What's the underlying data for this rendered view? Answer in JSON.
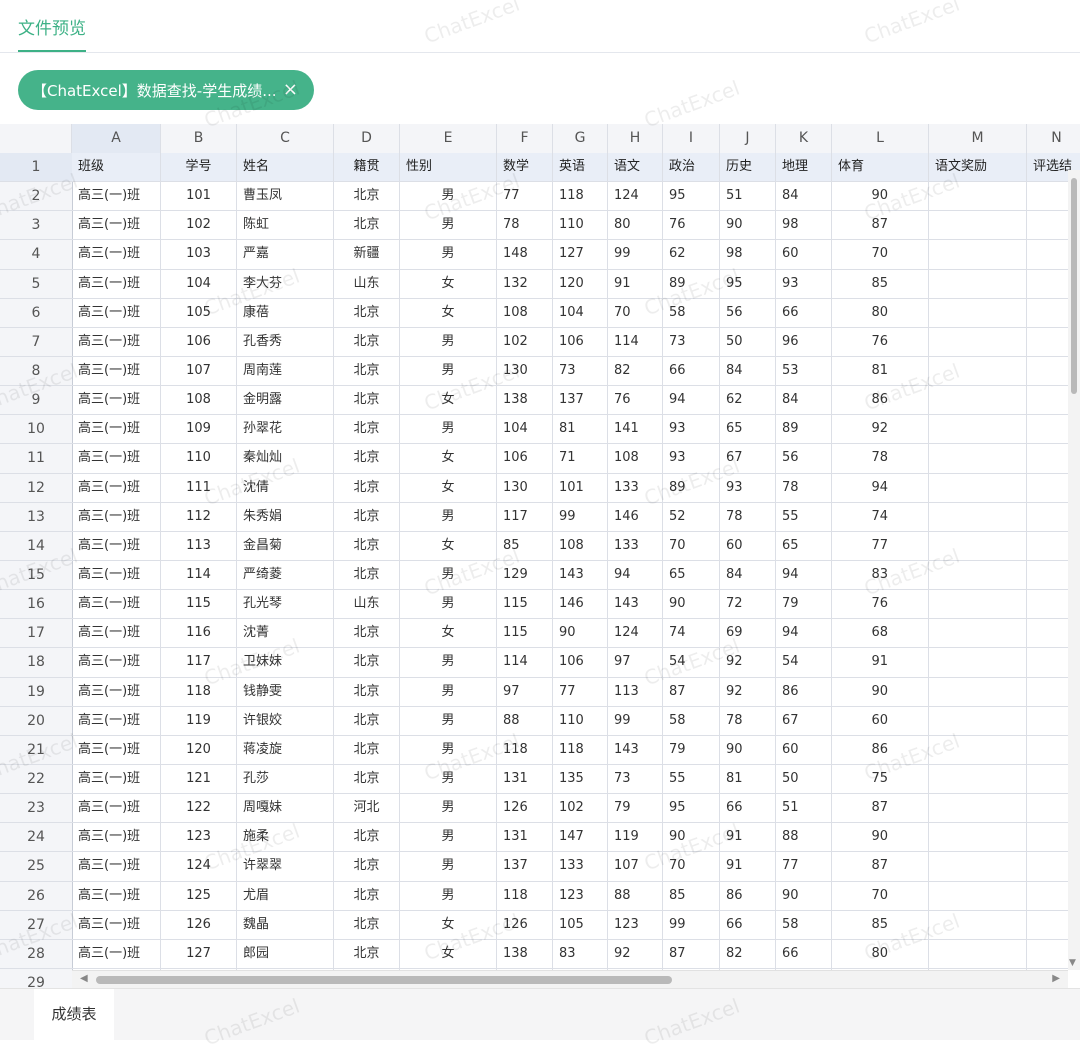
{
  "tabs": {
    "active": "文件预览"
  },
  "chip": {
    "label": "【ChatExcel】数据查找-学生成绩...",
    "close_icon": "×"
  },
  "columns": [
    "A",
    "B",
    "C",
    "D",
    "E",
    "F",
    "G",
    "H",
    "I",
    "J",
    "K",
    "L",
    "M",
    "N"
  ],
  "headers": [
    "班级",
    "学号",
    "姓名",
    "籍贯",
    "性别",
    "数学",
    "英语",
    "语文",
    "政治",
    "历史",
    "地理",
    "体育",
    "语文奖励",
    "评选结"
  ],
  "rows": [
    [
      "高三(一)班",
      "101",
      "曹玉凤",
      "北京",
      "男",
      "77",
      "118",
      "124",
      "95",
      "51",
      "84",
      "90"
    ],
    [
      "高三(一)班",
      "102",
      "陈虹",
      "北京",
      "男",
      "78",
      "110",
      "80",
      "76",
      "90",
      "98",
      "87"
    ],
    [
      "高三(一)班",
      "103",
      "严嘉",
      "新疆",
      "男",
      "148",
      "127",
      "99",
      "62",
      "98",
      "60",
      "70"
    ],
    [
      "高三(一)班",
      "104",
      "李大芬",
      "山东",
      "女",
      "132",
      "120",
      "91",
      "89",
      "95",
      "93",
      "85"
    ],
    [
      "高三(一)班",
      "105",
      "康蓓",
      "北京",
      "女",
      "108",
      "104",
      "70",
      "58",
      "56",
      "66",
      "80"
    ],
    [
      "高三(一)班",
      "106",
      "孔香秀",
      "北京",
      "男",
      "102",
      "106",
      "114",
      "73",
      "50",
      "96",
      "76"
    ],
    [
      "高三(一)班",
      "107",
      "周南莲",
      "北京",
      "男",
      "130",
      "73",
      "82",
      "66",
      "84",
      "53",
      "81"
    ],
    [
      "高三(一)班",
      "108",
      "金明露",
      "北京",
      "女",
      "138",
      "137",
      "76",
      "94",
      "62",
      "84",
      "86"
    ],
    [
      "高三(一)班",
      "109",
      "孙翠花",
      "北京",
      "男",
      "104",
      "81",
      "141",
      "93",
      "65",
      "89",
      "92"
    ],
    [
      "高三(一)班",
      "110",
      "秦灿灿",
      "北京",
      "女",
      "106",
      "71",
      "108",
      "93",
      "67",
      "56",
      "78"
    ],
    [
      "高三(一)班",
      "111",
      "沈倩",
      "北京",
      "女",
      "130",
      "101",
      "133",
      "89",
      "93",
      "78",
      "94"
    ],
    [
      "高三(一)班",
      "112",
      "朱秀娟",
      "北京",
      "男",
      "117",
      "99",
      "146",
      "52",
      "78",
      "55",
      "74"
    ],
    [
      "高三(一)班",
      "113",
      "金昌菊",
      "北京",
      "女",
      "85",
      "108",
      "133",
      "70",
      "60",
      "65",
      "77"
    ],
    [
      "高三(一)班",
      "114",
      "严绮菱",
      "北京",
      "男",
      "129",
      "143",
      "94",
      "65",
      "84",
      "94",
      "83"
    ],
    [
      "高三(一)班",
      "115",
      "孔光琴",
      "山东",
      "男",
      "115",
      "146",
      "143",
      "90",
      "72",
      "79",
      "76"
    ],
    [
      "高三(一)班",
      "116",
      "沈菁",
      "北京",
      "女",
      "115",
      "90",
      "124",
      "74",
      "69",
      "94",
      "68"
    ],
    [
      "高三(一)班",
      "117",
      "卫妹妹",
      "北京",
      "男",
      "114",
      "106",
      "97",
      "54",
      "92",
      "54",
      "91"
    ],
    [
      "高三(一)班",
      "118",
      "钱静雯",
      "北京",
      "男",
      "97",
      "77",
      "113",
      "87",
      "92",
      "86",
      "90"
    ],
    [
      "高三(一)班",
      "119",
      "许银姣",
      "北京",
      "男",
      "88",
      "110",
      "99",
      "58",
      "78",
      "67",
      "60"
    ],
    [
      "高三(一)班",
      "120",
      "蒋凌旋",
      "北京",
      "男",
      "118",
      "118",
      "143",
      "79",
      "90",
      "60",
      "86"
    ],
    [
      "高三(一)班",
      "121",
      "孔莎",
      "北京",
      "男",
      "131",
      "135",
      "73",
      "55",
      "81",
      "50",
      "75"
    ],
    [
      "高三(一)班",
      "122",
      "周嘎妹",
      "河北",
      "男",
      "126",
      "102",
      "79",
      "95",
      "66",
      "51",
      "87"
    ],
    [
      "高三(一)班",
      "123",
      "施柔",
      "北京",
      "男",
      "131",
      "147",
      "119",
      "90",
      "91",
      "88",
      "90"
    ],
    [
      "高三(一)班",
      "124",
      "许翠翠",
      "北京",
      "男",
      "137",
      "133",
      "107",
      "70",
      "91",
      "77",
      "87"
    ],
    [
      "高三(一)班",
      "125",
      "尤眉",
      "北京",
      "男",
      "118",
      "123",
      "88",
      "85",
      "86",
      "90",
      "70"
    ],
    [
      "高三(一)班",
      "126",
      "魏晶",
      "北京",
      "女",
      "126",
      "105",
      "123",
      "99",
      "66",
      "58",
      "85"
    ],
    [
      "高三(一)班",
      "127",
      "郎园",
      "北京",
      "女",
      "138",
      "83",
      "92",
      "87",
      "82",
      "66",
      "80"
    ]
  ],
  "sheet_tab": "成绩表",
  "watermark": "ChatExcel"
}
